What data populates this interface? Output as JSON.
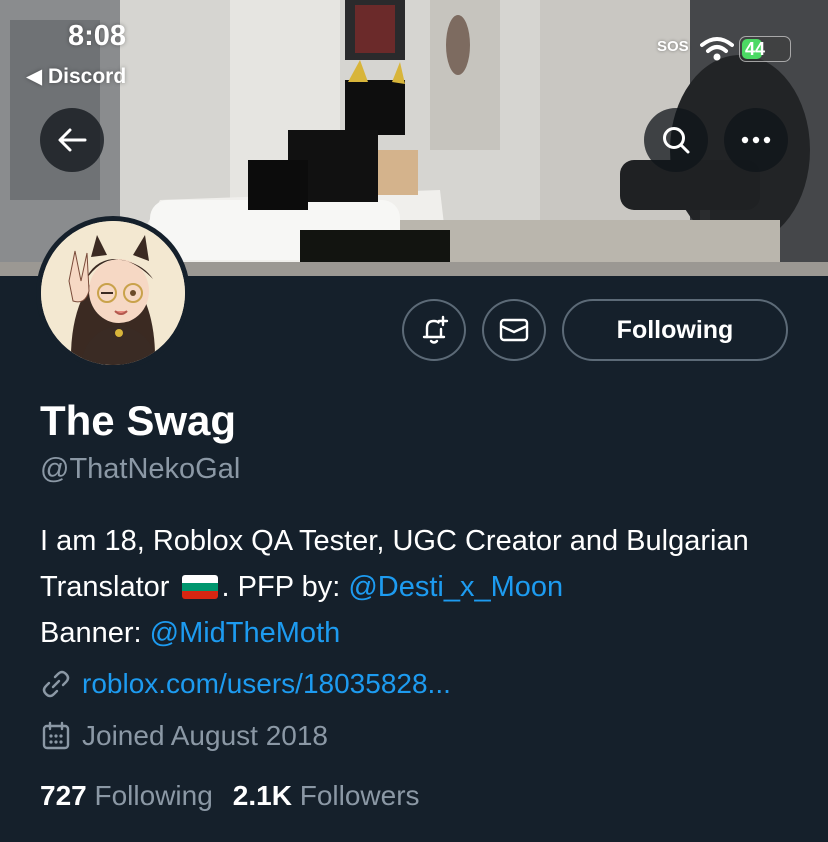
{
  "status_bar": {
    "time": "8:08",
    "back_app": "◀ Discord",
    "sos": "SOS",
    "battery": "44",
    "battery_level_percent": 44
  },
  "header": {
    "back_icon": "arrow-left-icon",
    "search_icon": "search-icon",
    "more_icon": "more-horizontal-icon"
  },
  "actions": {
    "notify_icon": "bell-plus-icon",
    "message_icon": "envelope-icon",
    "following_label": "Following"
  },
  "profile": {
    "display_name": "The Swag",
    "handle": "@ThatNekoGal",
    "bio_part1": "I am 18, Roblox QA Tester, UGC Creator and Bulgarian Translator",
    "bio_part2": ". PFP by: ",
    "bio_mention1": "@Desti_x_Moon",
    "bio_part3": "Banner: ",
    "bio_mention2": "@MidTheMoth",
    "flag": "bulgaria-flag",
    "website": "roblox.com/users/18035828...",
    "joined": "Joined August 2018",
    "following_count": "727",
    "following_label": "Following",
    "followers_count": "2.1K",
    "followers_label": "Followers"
  },
  "colors": {
    "background": "#15202b",
    "accent": "#1d9bf0",
    "muted_text": "#8b98a5",
    "button_border": "#5c6a77"
  }
}
